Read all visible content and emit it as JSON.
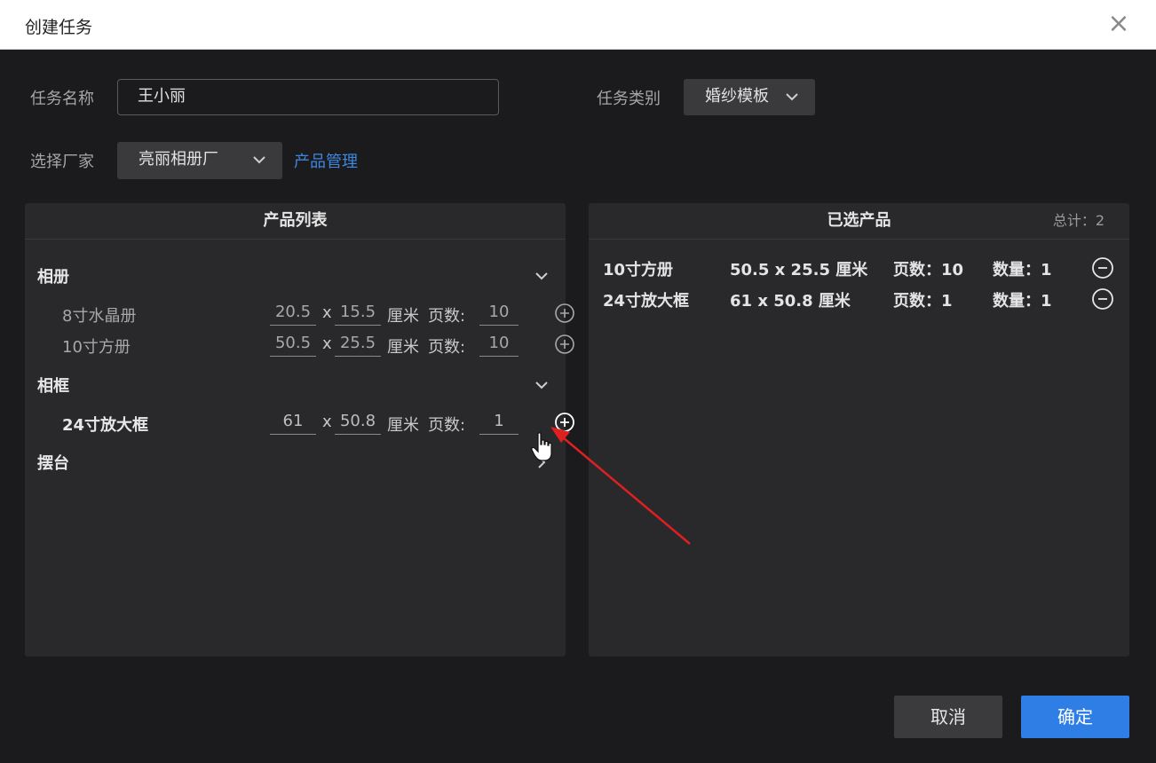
{
  "window": {
    "title": "创建任务",
    "close_icon": "close-icon"
  },
  "form": {
    "task_name_label": "任务名称",
    "task_name_value": "王小丽",
    "task_type_label": "任务类别",
    "task_type_value": "婚纱模板",
    "vendor_label": "选择厂家",
    "vendor_value": "亮丽相册厂",
    "product_manage_link": "产品管理"
  },
  "product_list": {
    "title": "产品列表",
    "categories": [
      {
        "label": "相册",
        "expanded": true
      },
      {
        "label": "相框",
        "expanded": true
      },
      {
        "label": "摆台",
        "expanded": false
      }
    ],
    "items": [
      {
        "name": "8寸水晶册",
        "width": "20.5",
        "height": "15.5",
        "x": "x",
        "unit": "厘米",
        "pages_label": "页数:",
        "pages": "10"
      },
      {
        "name": "10寸方册",
        "width": "50.5",
        "height": "25.5",
        "x": "x",
        "unit": "厘米",
        "pages_label": "页数:",
        "pages": "10"
      },
      {
        "name": "24寸放大框",
        "width": "61",
        "height": "50.8",
        "x": "x",
        "unit": "厘米",
        "pages_label": "页数:",
        "pages": "1"
      }
    ]
  },
  "selected": {
    "title": "已选产品",
    "total": "总计：2",
    "items": [
      {
        "name": "10寸方册",
        "size": "50.5 x 25.5 厘米",
        "pages": "页数：10",
        "qty": "数量：1"
      },
      {
        "name": "24寸放大框",
        "size": "61 x 50.8 厘米",
        "pages": "页数：1",
        "qty": "数量：1"
      }
    ]
  },
  "buttons": {
    "cancel": "取消",
    "ok": "确定"
  },
  "colors": {
    "accent": "#2f7ee6",
    "link": "#3d87e0",
    "annotation_arrow": "#e02020"
  }
}
